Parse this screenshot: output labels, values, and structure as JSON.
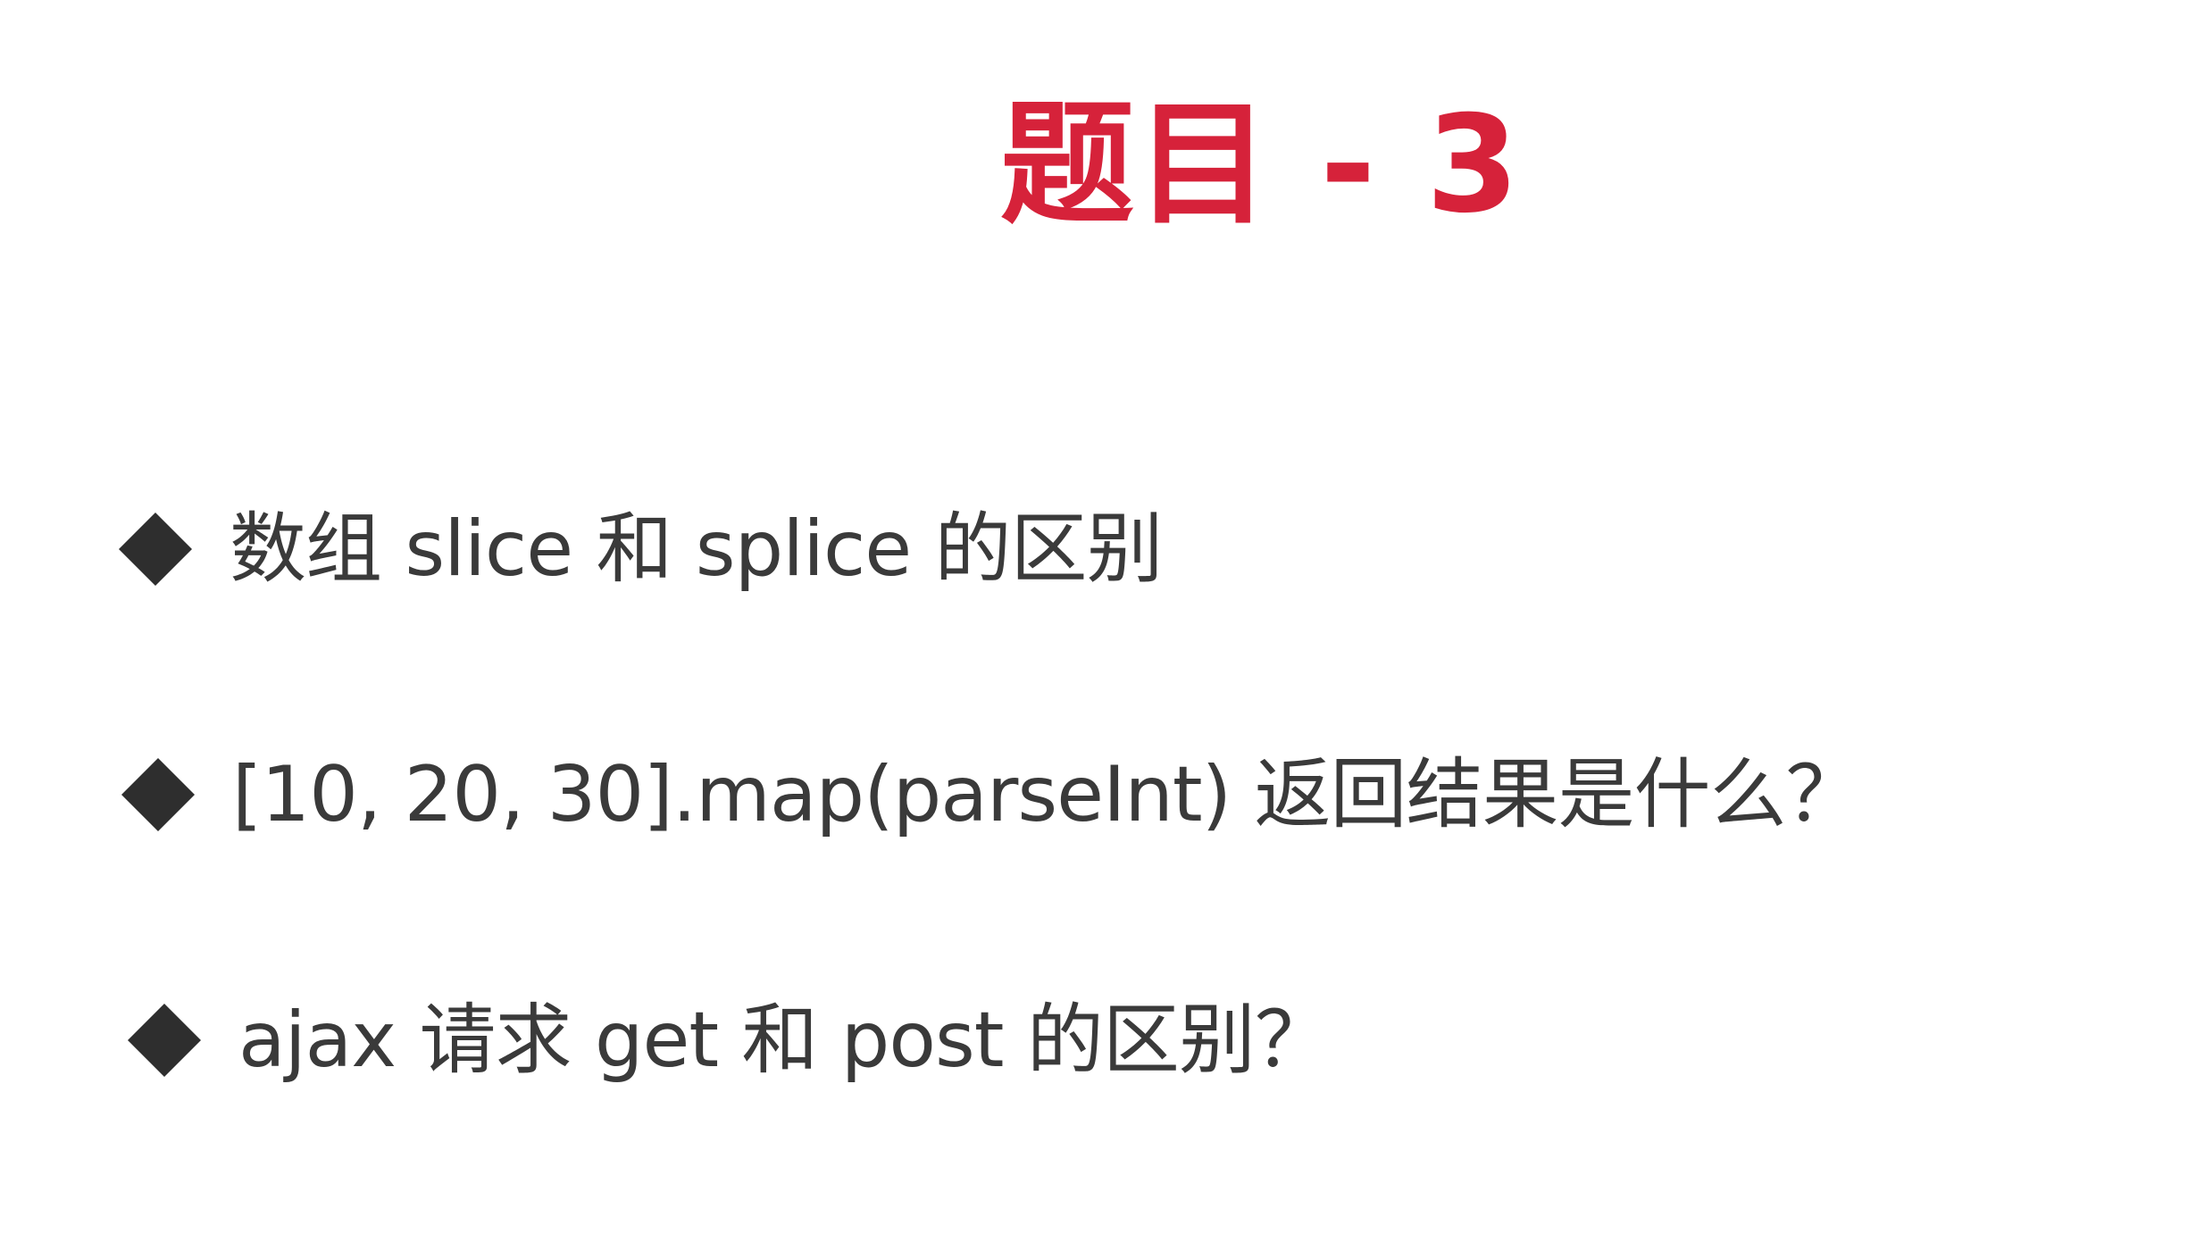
{
  "slide": {
    "title": "题目 - 3",
    "bullets": [
      {
        "text": "数组 slice 和 splice 的区别"
      },
      {
        "text": "[10, 20, 30].map(parseInt) 返回结果是什么？"
      },
      {
        "text": "ajax 请求 get 和 post 的区别？"
      }
    ],
    "bullet_icon": "diamond-icon"
  },
  "colors": {
    "title": "#d6223a",
    "text": "#3a3a3a",
    "bullet": "#2e2e2e",
    "background": "#ffffff"
  }
}
